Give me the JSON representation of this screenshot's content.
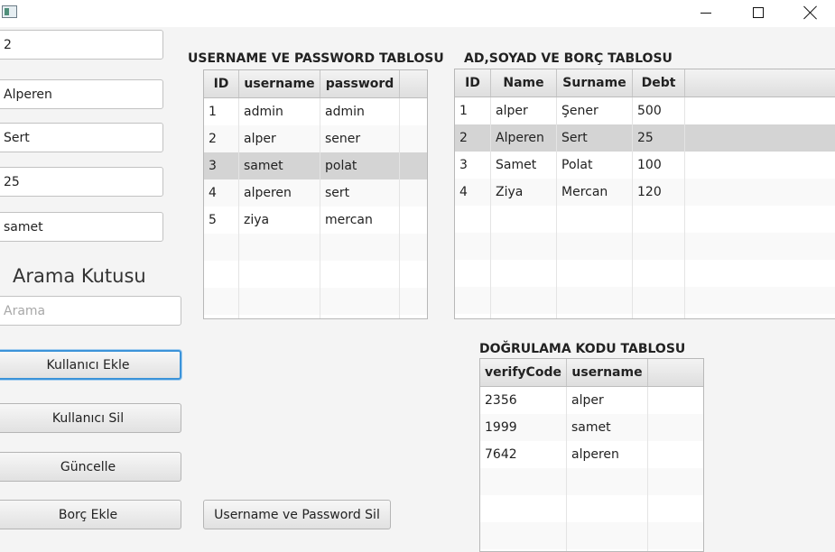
{
  "window": {
    "icon": "java-app-icon",
    "controls": [
      "minimize-icon",
      "maximize-icon",
      "close-icon"
    ]
  },
  "fields": [
    {
      "name": "id-field",
      "value": "2"
    },
    {
      "name": "name-field",
      "value": "Alperen"
    },
    {
      "name": "surname-field",
      "value": "Sert"
    },
    {
      "name": "debt-field",
      "value": "25"
    },
    {
      "name": "username-field",
      "value": "samet"
    }
  ],
  "search": {
    "label": "Arama Kutusu",
    "placeholder": "Arama",
    "value": ""
  },
  "buttons": {
    "add_user": "Kullanıcı Ekle",
    "delete_user": "Kullanıcı Sil",
    "update": "Güncelle",
    "add_debt": "Borç Ekle",
    "delete_credentials": "Username ve Password Sil"
  },
  "credentials_table": {
    "title": "USERNAME VE PASSWORD TABLOSU",
    "columns": [
      "ID",
      "username",
      "password"
    ],
    "rows": [
      [
        "1",
        "admin",
        "admin"
      ],
      [
        "2",
        "alper",
        "sener"
      ],
      [
        "3",
        "samet",
        "polat"
      ],
      [
        "4",
        "alperen",
        "sert"
      ],
      [
        "5",
        "ziya",
        "mercan"
      ]
    ],
    "selected_row": 2
  },
  "person_table": {
    "title": "AD,SOYAD VE BORÇ TABLOSU",
    "columns": [
      "ID",
      "Name",
      "Surname",
      "Debt"
    ],
    "rows": [
      [
        "1",
        "alper",
        "Şener",
        "500"
      ],
      [
        "2",
        "Alperen",
        "Sert",
        "25"
      ],
      [
        "3",
        "Samet",
        "Polat",
        "100"
      ],
      [
        "4",
        "Ziya",
        "Mercan",
        "120"
      ]
    ],
    "selected_row": 1
  },
  "verify_table": {
    "title": "DOĞRULAMA KODU TABLOSU",
    "columns": [
      "verifyCode",
      "username"
    ],
    "rows": [
      [
        "2356",
        "alper"
      ],
      [
        "1999",
        "samet"
      ],
      [
        "7642",
        "alperen"
      ]
    ],
    "selected_row": -1
  }
}
